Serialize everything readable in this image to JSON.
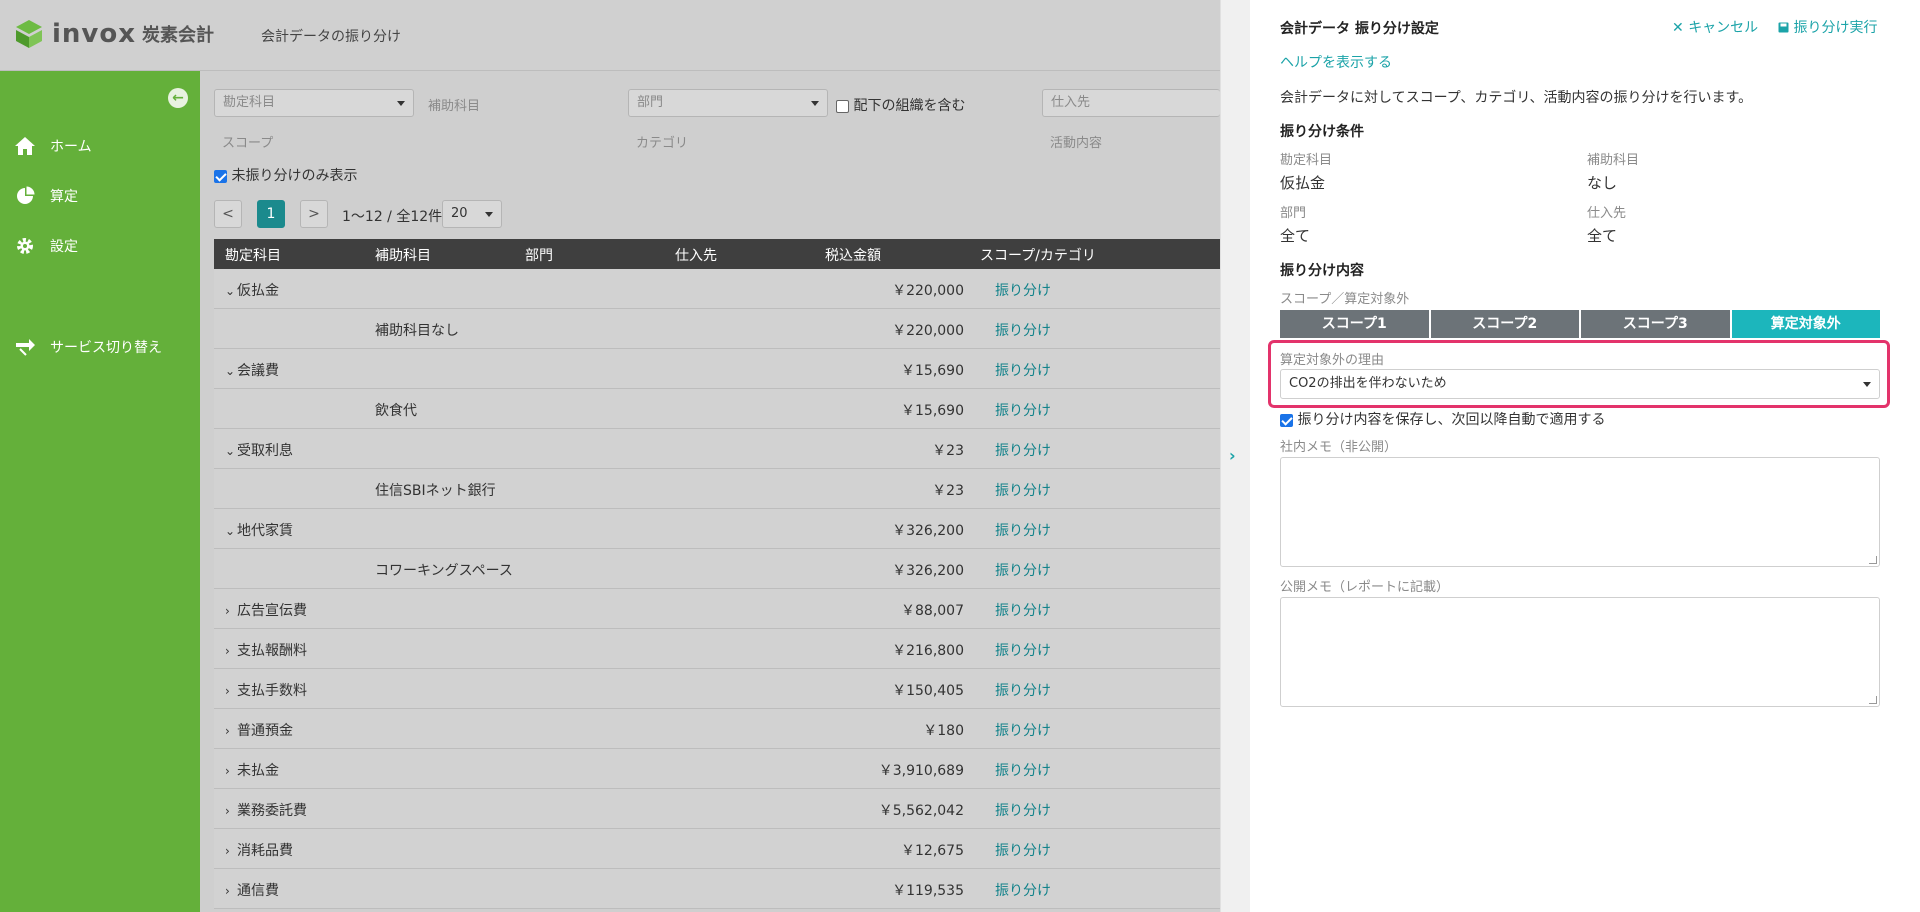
{
  "header": {
    "logo_text": "invox",
    "logo_sub": "炭素会計",
    "page_title": "会計データの振り分け"
  },
  "sidebar": {
    "items": [
      {
        "label": "ホーム",
        "icon": "home-icon"
      },
      {
        "label": "算定",
        "icon": "pie-chart-icon"
      },
      {
        "label": "設定",
        "icon": "gear-icon"
      },
      {
        "label": "サービス切り替え",
        "icon": "switch-icon"
      }
    ]
  },
  "filters": {
    "account_placeholder": "勘定科目",
    "sub_account_label": "補助科目",
    "dept_placeholder": "部門",
    "include_sub_orgs": "配下の組織を含む",
    "supplier_placeholder": "仕入先",
    "scope_label": "スコープ",
    "category_label": "カテゴリ",
    "activity_label": "活動内容",
    "unassigned_only": "未振り分けのみ表示"
  },
  "pagination": {
    "prev": "<",
    "current": "1",
    "next": ">",
    "range_text": "1〜12 / 全12件",
    "page_size": "20"
  },
  "table": {
    "headers": {
      "account": "勘定科目",
      "sub_account": "補助科目",
      "dept": "部門",
      "supplier": "仕入先",
      "amount": "税込金額",
      "scope": "スコープ/カテゴリ"
    },
    "assign_label": "振り分け",
    "rows": [
      {
        "type": "parent",
        "expanded": true,
        "account": "仮払金",
        "amount": "￥220,000"
      },
      {
        "type": "child",
        "sub": "補助科目なし",
        "amount": "￥220,000"
      },
      {
        "type": "parent",
        "expanded": true,
        "account": "会議費",
        "amount": "￥15,690"
      },
      {
        "type": "child",
        "sub": "飲食代",
        "amount": "￥15,690"
      },
      {
        "type": "parent",
        "expanded": true,
        "account": "受取利息",
        "amount": "￥23"
      },
      {
        "type": "child",
        "sub": "住信SBIネット銀行",
        "amount": "￥23"
      },
      {
        "type": "parent",
        "expanded": true,
        "account": "地代家賃",
        "amount": "￥326,200"
      },
      {
        "type": "child",
        "sub": "コワーキングスペース",
        "amount": "￥326,200"
      },
      {
        "type": "parent",
        "expanded": false,
        "account": "広告宣伝費",
        "amount": "￥88,007"
      },
      {
        "type": "parent",
        "expanded": false,
        "account": "支払報酬料",
        "amount": "￥216,800"
      },
      {
        "type": "parent",
        "expanded": false,
        "account": "支払手数料",
        "amount": "￥150,405"
      },
      {
        "type": "parent",
        "expanded": false,
        "account": "普通預金",
        "amount": "￥180"
      },
      {
        "type": "parent",
        "expanded": false,
        "account": "未払金",
        "amount": "￥3,910,689"
      },
      {
        "type": "parent",
        "expanded": false,
        "account": "業務委託費",
        "amount": "￥5,562,042"
      },
      {
        "type": "parent",
        "expanded": false,
        "account": "消耗品費",
        "amount": "￥12,675"
      },
      {
        "type": "parent",
        "expanded": false,
        "account": "通信費",
        "amount": "￥119,535"
      }
    ]
  },
  "panel": {
    "title": "会計データ 振り分け設定",
    "cancel": "キャンセル",
    "run": "振り分け実行",
    "help": "ヘルプを表示する",
    "description": "会計データに対してスコープ、カテゴリ、活動内容の振り分けを行います。",
    "conditions_title": "振り分け条件",
    "cond": {
      "account_label": "勘定科目",
      "account_value": "仮払金",
      "sub_label": "補助科目",
      "sub_value": "なし",
      "dept_label": "部門",
      "dept_value": "全て",
      "supplier_label": "仕入先",
      "supplier_value": "全て"
    },
    "content_title": "振り分け内容",
    "scope_label": "スコープ／算定対象外",
    "scope_tabs": [
      "スコープ1",
      "スコープ2",
      "スコープ3",
      "算定対象外"
    ],
    "active_tab": "算定対象外",
    "reason_label": "算定対象外の理由",
    "reason_value": "CO2の排出を伴わないため",
    "save_check": "振り分け内容を保存し、次回以降自動で適用する",
    "internal_memo_label": "社内メモ（非公開）",
    "public_memo_label": "公開メモ（レポートに記載）"
  },
  "colors": {
    "sidebar": "#64b03a",
    "accent": "#1ba3a8",
    "highlight": "#e3336b",
    "table_header": "#3f3f3f"
  }
}
